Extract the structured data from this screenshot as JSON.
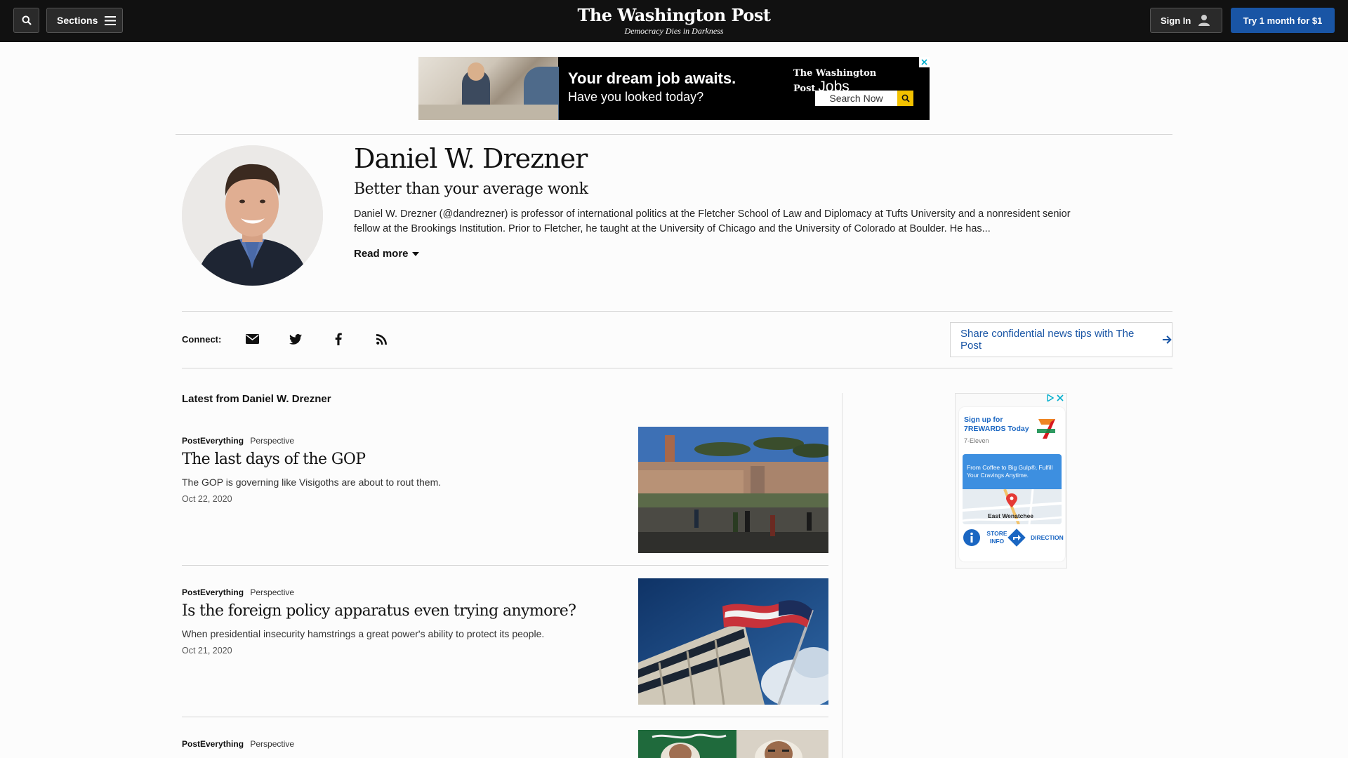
{
  "nav": {
    "sections_label": "Sections",
    "masthead": "The Washington Post",
    "tagline": "Democracy Dies in Darkness",
    "signin_label": "Sign In",
    "try_label": "Try 1 month for $1"
  },
  "top_ad": {
    "line1": "Your dream job awaits.",
    "line2": "Have you looked today?",
    "brand": "The Washington Post",
    "brand_suffix": "Jobs",
    "search_label": "Search Now"
  },
  "author": {
    "name": "Daniel W. Drezner",
    "tagline": "Better than your average wonk",
    "bio": "Daniel W. Drezner (@dandrezner) is professor of international politics at the Fletcher School of Law and Diplomacy at Tufts University and a nonresident senior fellow at the Brookings Institution. Prior to Fletcher, he taught at the University of Chicago and the University of Colorado at Boulder. He has...",
    "read_more": "Read more"
  },
  "connect": {
    "label": "Connect:",
    "icons": [
      "email-icon",
      "twitter-icon",
      "facebook-icon",
      "rss-icon"
    ],
    "tips_label": "Share confidential news tips with The Post"
  },
  "latest": {
    "title": "Latest from Daniel W. Drezner",
    "stories": [
      {
        "section": "PostEverything",
        "label": "Perspective",
        "headline": "The last days of the GOP",
        "blurb": "The GOP is governing like Visigoths are about to rout them.",
        "date": "Oct 22, 2020"
      },
      {
        "section": "PostEverything",
        "label": "Perspective",
        "headline": "Is the foreign policy apparatus even trying anymore?",
        "blurb": "When presidential insecurity hamstrings a great power's ability to protect its people.",
        "date": "Oct 21, 2020"
      },
      {
        "section": "PostEverything",
        "label": "Perspective"
      }
    ]
  },
  "side_ad": {
    "signup": "Sign up for 7REWARDS Today",
    "brand": "7-Eleven",
    "promo": "From Coffee to Big Gulp®, Fulfill Your Cravings Anytime.",
    "map_label": "East Wenatchee",
    "store_info": "STORE INFO",
    "directions": "DIRECTION"
  },
  "colors": {
    "nav_bg": "#111111",
    "accent_blue": "#1955a5",
    "page_bg": "#fcfcfc"
  }
}
